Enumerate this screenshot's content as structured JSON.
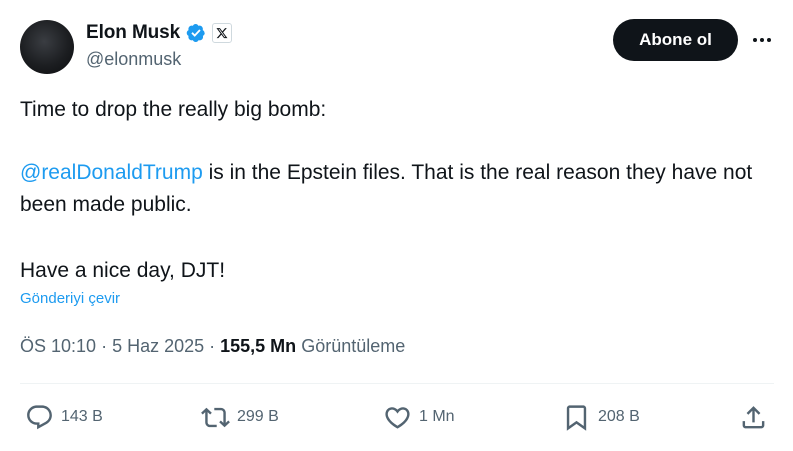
{
  "author": {
    "display_name": "Elon Musk",
    "handle": "@elonmusk"
  },
  "header": {
    "subscribe_label": "Abone ol"
  },
  "tweet": {
    "line1": "Time to drop the really big bomb:",
    "mention": "@realDonaldTrump",
    "line2_rest": " is in the Epstein files. That is the real reason they have not been made public.",
    "line3": "Have a nice day, DJT!",
    "translate_label": "Gönderiyi çevir"
  },
  "meta": {
    "time": "ÖS 10:10",
    "sep1": " · ",
    "date": "5 Haz 2025",
    "sep2": " · ",
    "views_count": "155,5 Mn",
    "views_label": "Görüntüleme"
  },
  "actions": {
    "replies": "143 B",
    "reposts": "299 B",
    "likes": "1 Mn",
    "bookmarks": "208 B"
  },
  "colors": {
    "accent": "#1d9bf0",
    "text": "#0f1419",
    "muted": "#536471",
    "verified": "#1d9bf0"
  },
  "icons": [
    "verified-badge-icon",
    "x-logo-icon",
    "more-icon",
    "reply-icon",
    "repost-icon",
    "like-icon",
    "bookmark-icon",
    "share-icon"
  ]
}
